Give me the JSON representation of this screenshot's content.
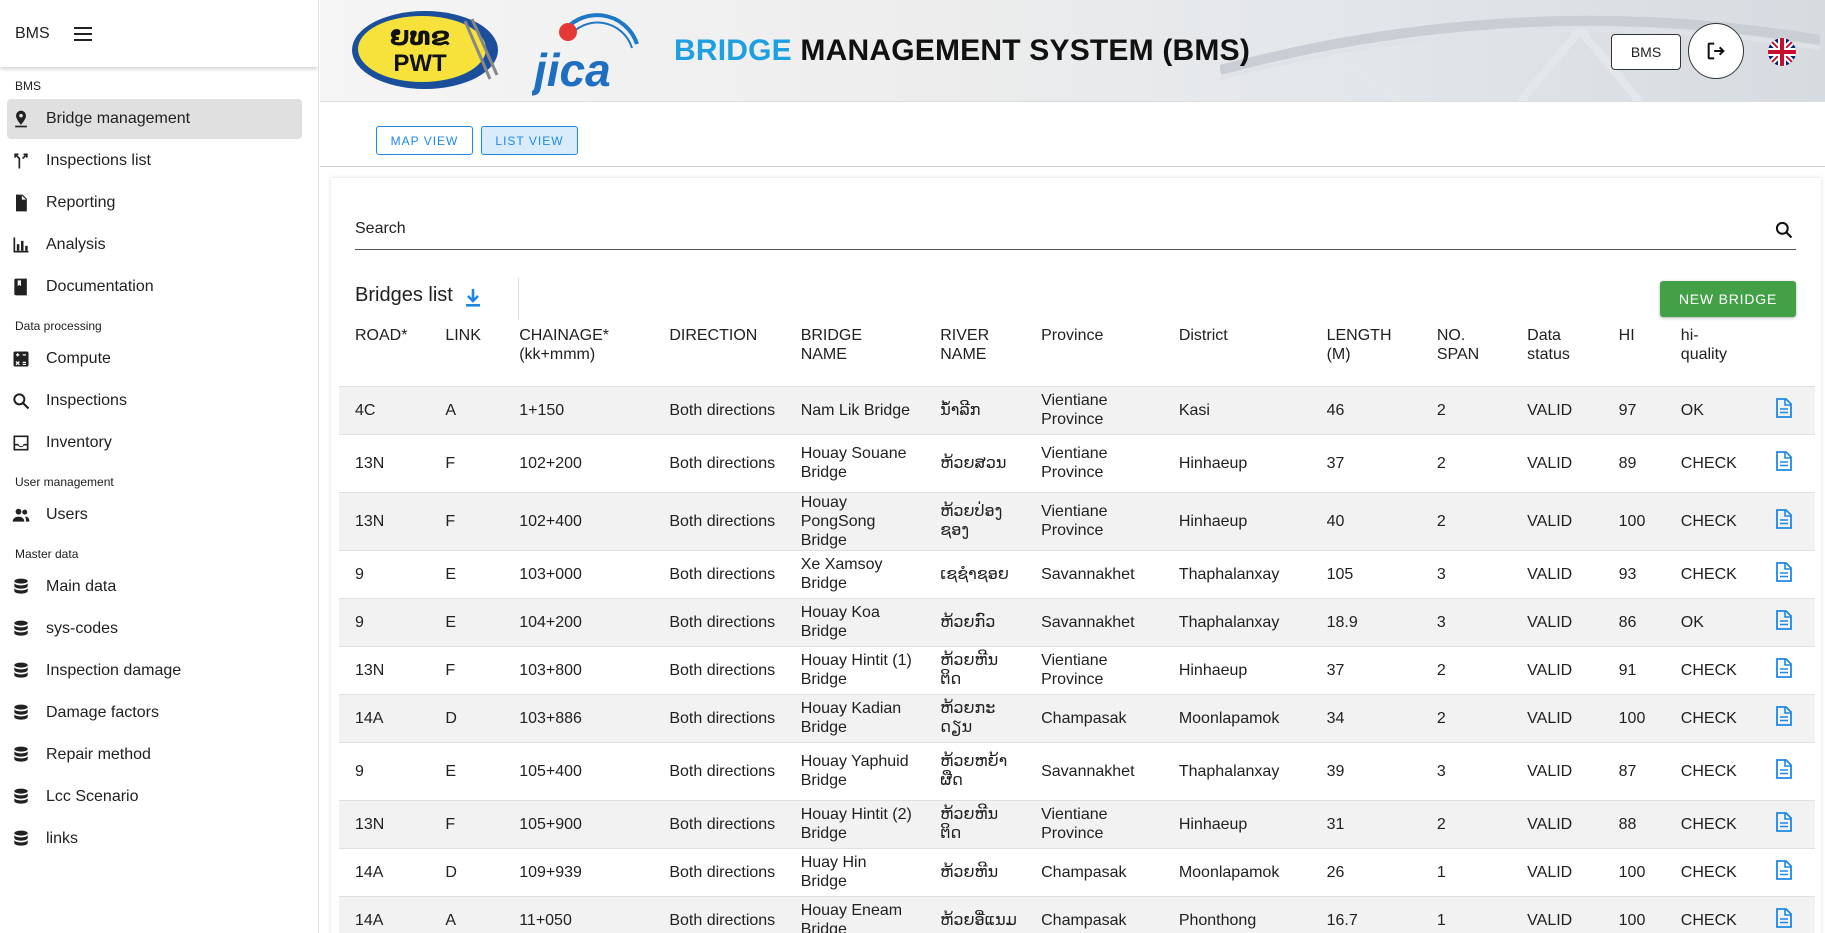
{
  "sidebar": {
    "brand": "BMS",
    "sections": [
      {
        "title": "BMS",
        "items": [
          {
            "label": "Bridge management",
            "icon": "map-pin-icon",
            "active": true
          },
          {
            "label": "Inspections list",
            "icon": "merge-icon"
          },
          {
            "label": "Reporting",
            "icon": "document-icon"
          },
          {
            "label": "Analysis",
            "icon": "bar-chart-icon"
          },
          {
            "label": "Documentation",
            "icon": "book-icon"
          }
        ]
      },
      {
        "title": "Data processing",
        "items": [
          {
            "label": "Compute",
            "icon": "calculator-icon"
          },
          {
            "label": "Inspections",
            "icon": "search-icon"
          },
          {
            "label": "Inventory",
            "icon": "inbox-icon"
          }
        ]
      },
      {
        "title": "User management",
        "items": [
          {
            "label": "Users",
            "icon": "users-icon"
          }
        ]
      },
      {
        "title": "Master data",
        "items": [
          {
            "label": "Main data",
            "icon": "database-icon"
          },
          {
            "label": "sys-codes",
            "icon": "database-icon"
          },
          {
            "label": "Inspection damage",
            "icon": "database-icon"
          },
          {
            "label": "Damage factors",
            "icon": "database-icon"
          },
          {
            "label": "Repair method",
            "icon": "database-icon"
          },
          {
            "label": "Lcc Scenario",
            "icon": "database-icon"
          },
          {
            "label": "links",
            "icon": "database-icon"
          }
        ]
      }
    ]
  },
  "header": {
    "logo_pwt_top": "ຍທຂ",
    "logo_pwt_bottom": "PWT",
    "logo_jica": "jica",
    "title_part1": "BRIDGE",
    "title_part2": "MANAGEMENT SYSTEM (BMS)",
    "bms_button": "BMS"
  },
  "viewbar": {
    "map_view": "MAP VIEW",
    "list_view": "LIST VIEW"
  },
  "main": {
    "search_placeholder": "Search",
    "list_title": "Bridges list",
    "new_bridge": "NEW BRIDGE",
    "columns": [
      "ROAD*",
      "LINK",
      "CHAINAGE*\n(kk+mmm)",
      "DIRECTION",
      "BRIDGE\nNAME",
      "RIVER\nNAME",
      "Province",
      "District",
      "LENGTH\n(M)",
      "NO.\nSPAN",
      "Data\nstatus",
      "HI",
      "hi-\nquality"
    ],
    "rows": [
      {
        "road": "4C",
        "link": "A",
        "chainage": "1+150",
        "direction": "Both directions",
        "bridge": "Nam Lik Bridge",
        "river": "ນ້ຳລີກ",
        "province": "Vientiane Province",
        "district": "Kasi",
        "length": "46",
        "span": "2",
        "status": "VALID",
        "hi": "97",
        "quality": "OK"
      },
      {
        "road": "13N",
        "link": "F",
        "chainage": "102+200",
        "direction": "Both directions",
        "bridge": "Houay Souane Bridge",
        "river": "ຫ້ວຍສວນ",
        "province": "Vientiane Province",
        "district": "Hinhaeup",
        "length": "37",
        "span": "2",
        "status": "VALID",
        "hi": "89",
        "quality": "CHECK"
      },
      {
        "road": "13N",
        "link": "F",
        "chainage": "102+400",
        "direction": "Both directions",
        "bridge": "Houay PongSong Bridge",
        "river": "ຫ້ວຍປ່ອງ ຊອງ",
        "province": "Vientiane Province",
        "district": "Hinhaeup",
        "length": "40",
        "span": "2",
        "status": "VALID",
        "hi": "100",
        "quality": "CHECK"
      },
      {
        "road": "9",
        "link": "E",
        "chainage": "103+000",
        "direction": "Both directions",
        "bridge": "Xe Xamsoy Bridge",
        "river": "ເຊຊຳຊອຍ",
        "province": "Savannakhet",
        "district": "Thaphalanxay",
        "length": "105",
        "span": "3",
        "status": "VALID",
        "hi": "93",
        "quality": "CHECK"
      },
      {
        "road": "9",
        "link": "E",
        "chainage": "104+200",
        "direction": "Both directions",
        "bridge": "Houay Koa Bridge",
        "river": "ຫ້ວຍກົວ",
        "province": "Savannakhet",
        "district": "Thaphalanxay",
        "length": "18.9",
        "span": "3",
        "status": "VALID",
        "hi": "86",
        "quality": "OK"
      },
      {
        "road": "13N",
        "link": "F",
        "chainage": "103+800",
        "direction": "Both directions",
        "bridge": "Houay Hintit (1) Bridge",
        "river": "ຫ້ວຍຫີນ ຕິດ",
        "province": "Vientiane Province",
        "district": "Hinhaeup",
        "length": "37",
        "span": "2",
        "status": "VALID",
        "hi": "91",
        "quality": "CHECK"
      },
      {
        "road": "14A",
        "link": "D",
        "chainage": "103+886",
        "direction": "Both directions",
        "bridge": "Houay Kadian Bridge",
        "river": "ຫ້ວຍກະ ດຽນ",
        "province": "Champasak",
        "district": "Moonlapamok",
        "length": "34",
        "span": "2",
        "status": "VALID",
        "hi": "100",
        "quality": "CHECK"
      },
      {
        "road": "9",
        "link": "E",
        "chainage": "105+400",
        "direction": "Both directions",
        "bridge": "Houay Yaphuid Bridge",
        "river": "ຫ້ວຍຫຍ້າ ຜືດ",
        "province": "Savannakhet",
        "district": "Thaphalanxay",
        "length": "39",
        "span": "3",
        "status": "VALID",
        "hi": "87",
        "quality": "CHECK"
      },
      {
        "road": "13N",
        "link": "F",
        "chainage": "105+900",
        "direction": "Both directions",
        "bridge": "Houay Hintit (2) Bridge",
        "river": "ຫ້ວຍຫີນ ຕິດ",
        "province": "Vientiane Province",
        "district": "Hinhaeup",
        "length": "31",
        "span": "2",
        "status": "VALID",
        "hi": "88",
        "quality": "CHECK"
      },
      {
        "road": "14A",
        "link": "D",
        "chainage": "109+939",
        "direction": "Both directions",
        "bridge": "Huay Hin Bridge",
        "river": "ຫ້ວຍຫີນ",
        "province": "Champasak",
        "district": "Moonlapamok",
        "length": "26",
        "span": "1",
        "status": "VALID",
        "hi": "100",
        "quality": "CHECK"
      },
      {
        "road": "14A",
        "link": "A",
        "chainage": "11+050",
        "direction": "Both directions",
        "bridge": "Houay Eneam Bridge",
        "river": "ຫ້ວຍອີ່ແນມ",
        "province": "Champasak",
        "district": "Phonthong",
        "length": "16.7",
        "span": "1",
        "status": "VALID",
        "hi": "100",
        "quality": "CHECK"
      }
    ]
  },
  "colors": {
    "accent": "#1e88e5",
    "new_button": "#43a047",
    "title_blue": "#1ea0e0"
  }
}
